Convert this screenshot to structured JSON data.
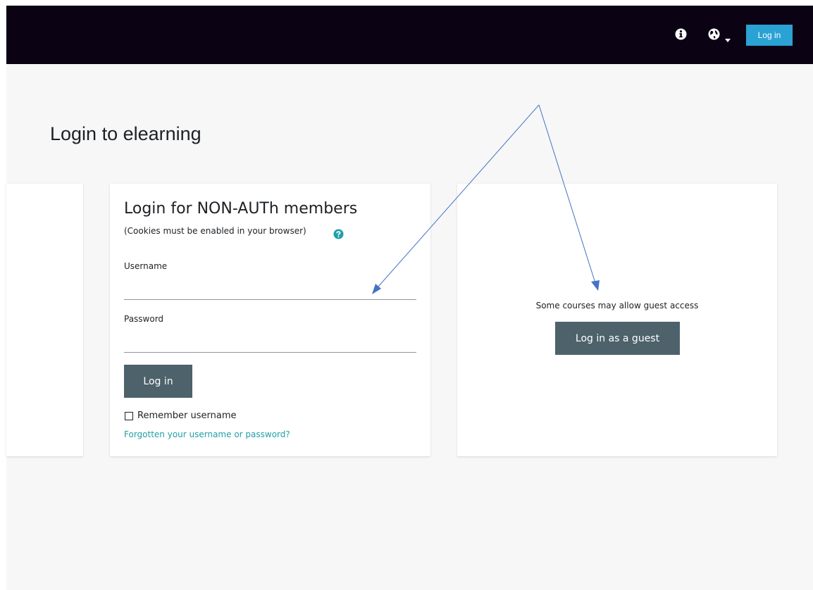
{
  "header": {
    "icons": {
      "info": "info-icon",
      "language": "globe-icon",
      "caret": "chevron-down-icon"
    },
    "login_label": "Log in",
    "colors": {
      "background": "#0b0314",
      "login_button": "#2aa2d4"
    }
  },
  "page": {
    "title": "Login to elearning"
  },
  "login_form": {
    "heading": "Login for NON-AUTh members",
    "cookies_note": "(Cookies must be enabled in your browser)",
    "help_icon": "question-circle-icon",
    "username_label": "Username",
    "username_value": "",
    "password_label": "Password",
    "password_value": "",
    "login_button_label": "Log in",
    "remember_label": "Remember username",
    "remember_checked": false,
    "forgot_link": "Forgotten your username or password?"
  },
  "guest": {
    "note": "Some courses may allow guest access",
    "button_label": "Log in as a guest"
  },
  "colors": {
    "primary_button": "#4d626b",
    "link": "#1f9fa9",
    "annotation_arrow": "#4472c4",
    "page_background": "#f7f7f7"
  }
}
